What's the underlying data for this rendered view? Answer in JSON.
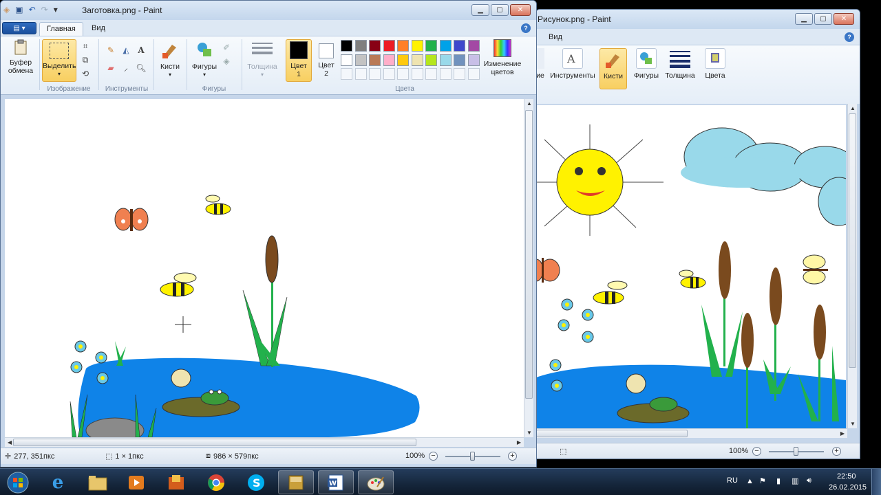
{
  "left_window": {
    "title": "Заготовка.png - Paint",
    "tabs": [
      "Главная",
      "Вид"
    ],
    "ribbon": {
      "clipboard_label": "Буфер обмена",
      "select_label": "Выделить",
      "group_image": "Изображение",
      "group_tools": "Инструменты",
      "brushes_label": "Кисти",
      "shapes_label": "Фигуры",
      "group_shapes": "Фигуры",
      "thickness_label": "Толщина",
      "color1_label": "Цвет 1",
      "color2_label": "Цвет 2",
      "group_colors": "Цвета",
      "edit_colors_label": "Изменение цветов"
    },
    "status": {
      "cursor_pos": "277, 351пкс",
      "selection_size": "1 × 1пкс",
      "image_size": "986 × 579пкс",
      "zoom": "100%"
    }
  },
  "right_window": {
    "title": "Рисунок.png - Paint",
    "tabs": [
      "Вид"
    ],
    "ribbon": {
      "partial_label": "ие",
      "tools_label": "Инструменты",
      "brushes_label": "Кисти",
      "shapes_label": "Фигуры",
      "thickness_label": "Толщина",
      "colors_label": "Цвета"
    },
    "status": {
      "zoom": "100%"
    }
  },
  "palette": [
    "#000000",
    "#7f7f7f",
    "#880015",
    "#ed1c24",
    "#ff7f27",
    "#fff200",
    "#22b14c",
    "#00a2e8",
    "#3f48cc",
    "#a349a4",
    "#ffffff",
    "#c3c3c3",
    "#b97a57",
    "#ffaec9",
    "#ffc90e",
    "#efe4b0",
    "#b5e61d",
    "#99d9ea",
    "#7092be",
    "#c8bfe7"
  ],
  "taskbar": {
    "language": "RU",
    "time": "22:50",
    "date": "26.02.2015",
    "apps": [
      "start-orb",
      "internet-explorer",
      "file-explorer",
      "media-player",
      "paint-net",
      "chrome",
      "skype",
      "archive",
      "word",
      "paint"
    ]
  },
  "accent": "#2f6cc0"
}
